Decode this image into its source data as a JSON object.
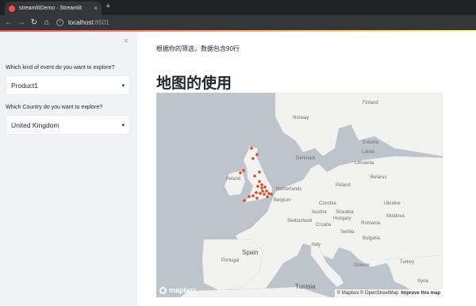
{
  "browser": {
    "tab_title": "streamlitDemo · Streamlit",
    "tab_close": "×",
    "new_tab": "+",
    "url_host": "localhost",
    "url_port": ":8501"
  },
  "sidebar": {
    "close": "×",
    "event_label": "Which kind of event do you want to explore?",
    "event_value": "Product1",
    "country_label": "Which Country do you want to explore?",
    "country_value": "United Kingdom"
  },
  "main": {
    "info_text": "根据你的筛选，数据包含90行",
    "title": "地图的使用"
  },
  "map": {
    "labels": {
      "finland": "Finland",
      "norway": "Norway",
      "estonia": "Estonia",
      "latvia": "Latvia",
      "denmark": "Denmark",
      "lithuania": "Lithuania",
      "belarus": "Belarus",
      "ireland": "Ireland",
      "netherlands": "Netherlands",
      "poland": "Poland",
      "belgium": "Belgium",
      "czechia": "Czechia",
      "ukraine": "Ukraine",
      "slovakia": "Slovakia",
      "moldova": "Moldova",
      "austria": "Austria",
      "hungary": "Hungary",
      "switzerland": "Switzerland",
      "romania": "Romania",
      "croatia": "Croatia",
      "serbia": "Serbia",
      "bulgaria": "Bulgaria",
      "italy": "Italy",
      "portugal": "Portugal",
      "spain": "Spain",
      "greece": "Greece",
      "turkey": "Turkey",
      "tunisia": "Tunisia",
      "syria": "Syria"
    },
    "logo": "mapbox",
    "attribution": "© Mapbox © OpenStreetMap",
    "improve": "Improve this map",
    "point_color": "#d8491e",
    "land_color": "#f2f2f0",
    "water_color": "#bcc4cc"
  }
}
